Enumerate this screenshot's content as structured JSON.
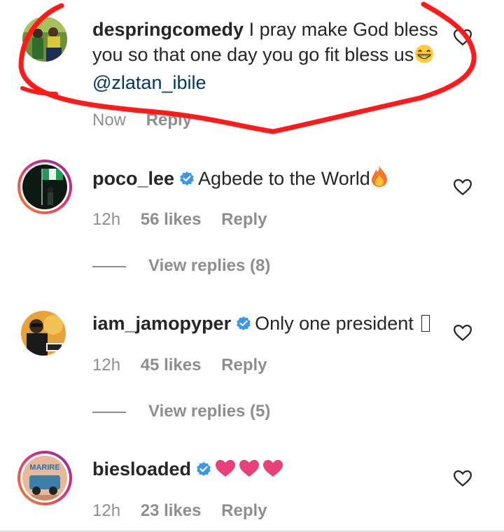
{
  "comments": [
    {
      "username": "despringcomedy",
      "text": "I pray make God bless you so that one day you go fit bless us",
      "mention": "@zlatan_ibile",
      "time": "Now",
      "reply": "Reply"
    },
    {
      "username": "poco_lee",
      "text": "Agbede to the World",
      "time": "12h",
      "likes": "56 likes",
      "reply": "Reply",
      "view_replies": "View replies (8)"
    },
    {
      "username": "iam_jamopyper",
      "text": "Only one president",
      "time": "12h",
      "likes": "45 likes",
      "reply": "Reply",
      "view_replies": "View replies (5)"
    },
    {
      "username": "biesloaded",
      "text": "",
      "avatar_text": "MARIRE",
      "time": "12h",
      "likes": "23 likes",
      "reply": "Reply"
    }
  ],
  "colors": {
    "username": "#262626",
    "mention": "#00376b",
    "meta": "#8e8e8e",
    "verified": "#3897f0",
    "scribble": "#ff1a1a",
    "hearts": "#e8417a"
  },
  "icons": [
    "heart-outline-icon",
    "verified-badge-icon",
    "fire-emoji",
    "grinning-emoji",
    "pink-heart-emoji"
  ]
}
